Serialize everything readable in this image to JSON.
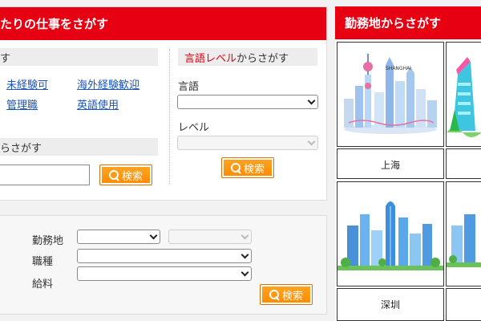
{
  "left": {
    "title": "たりの仕事をさがす",
    "condition_header": "す",
    "links": [
      "未経験可",
      "海外経験歓迎",
      "管理職",
      "英語使用"
    ],
    "language_header_red": "言語レベル",
    "language_header_rest": "からさがす",
    "language_label": "言語",
    "level_label": "レベル",
    "keyword_header": "らさがす",
    "search_label": "検索"
  },
  "bottom": {
    "location_label": "勤務地",
    "category_label": "職種",
    "salary_label": "給料",
    "search_label": "検索"
  },
  "right": {
    "title": "勤務地からさがす",
    "skyline_caption": "SHANGHAI",
    "cities": [
      "上海",
      "深圳"
    ]
  },
  "colors": {
    "brand_red": "#e60012",
    "button_orange": "#ff8a00",
    "link_blue": "#1a55b8"
  }
}
